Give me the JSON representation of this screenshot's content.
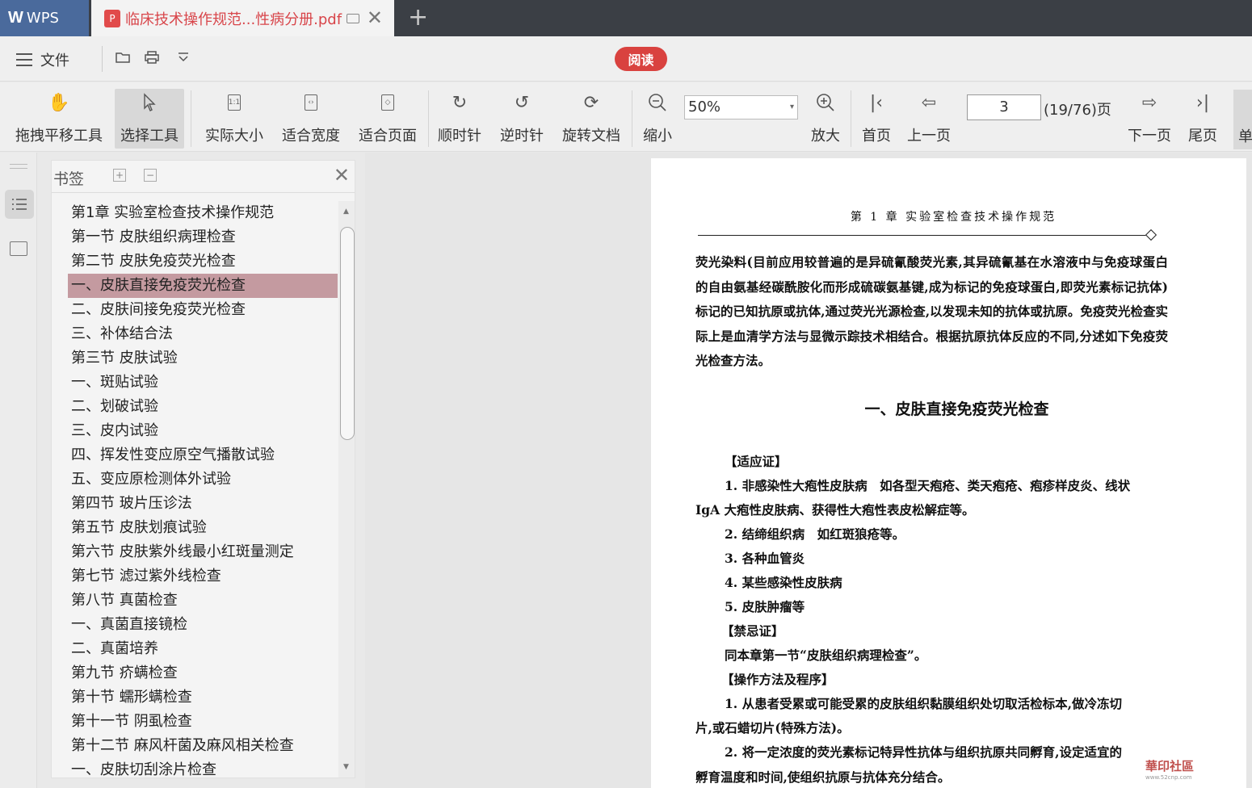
{
  "titlebar": {
    "app_name": "WPS",
    "doc_tab_title": "临床技术操作规范...性病分册.pdf",
    "pdf_badge": "P"
  },
  "menubar": {
    "file_label": "文件",
    "read_label": "阅读"
  },
  "toolbar": {
    "pan_tool": "拖拽平移工具",
    "select_tool": "选择工具",
    "actual_size": "实际大小",
    "fit_width": "适合宽度",
    "fit_page": "适合页面",
    "clockwise": "顺时针",
    "counterclockwise": "逆时针",
    "rotate_doc": "旋转文档",
    "zoom_out": "缩小",
    "zoom_value": "50%",
    "zoom_in": "放大",
    "first_page": "首页",
    "prev_page": "上一页",
    "page_input": "3",
    "page_total": "(19/76)页",
    "next_page": "下一页",
    "last_page": "尾页",
    "single_page": "单"
  },
  "bookmarks": {
    "title": "书签",
    "items": [
      "第1章 实验室检查技术操作规范",
      "第一节 皮肤组织病理检查",
      "第二节 皮肤免疫荧光检查",
      "一、皮肤直接免疫荧光检查",
      "二、皮肤间接免疫荧光检查",
      "三、补体结合法",
      "第三节 皮肤试验",
      "一、斑贴试验",
      "二、划破试验",
      "三、皮内试验",
      "四、挥发性变应原空气播散试验",
      "五、变应原检测体外试验",
      "第四节 玻片压诊法",
      "第五节 皮肤划痕试验",
      "第六节 皮肤紫外线最小红斑量测定",
      "第七节 滤过紫外线检查",
      "第八节 真菌检查",
      "一、真菌直接镜检",
      "二、真菌培养",
      "第九节 疥螨检查",
      "第十节 蠕形螨检查",
      "第十一节 阴虱检查",
      "第十二节 麻风杆菌及麻风相关检查",
      "一、皮肤切刮涂片检查"
    ],
    "selected_index": 3
  },
  "document": {
    "header": "第 1 章 实验室检查技术操作规范",
    "paragraph": "荧光染料(目前应用较普遍的是异硫氰酸荧光素,其异硫氰基在水溶液中与免疫球蛋白的自由氨基经碳酰胺化而形成硫碳氨基键,成为标记的免疫球蛋白,即荧光素标记抗体)标记的已知抗原或抗体,通过荧光光源检查,以发现未知的抗体或抗原。免疫荧光检查实际上是血清学方法与显微示踪技术相结合。根据抗原抗体反应的不同,分述如下免疫荧光检查方法。",
    "heading": "一、皮肤直接免疫荧光检查",
    "lines": [
      "【适应证】",
      "1. 非感染性大疱性皮肤病　如各型天疱疮、类天疱疮、疱疹样皮炎、线状",
      "IgA 大疱性皮肤病、获得性大疱性表皮松解症等。",
      "2. 结缔组织病　如红斑狼疮等。",
      "3. 各种血管炎",
      "4. 某些感染性皮肤病",
      "5. 皮肤肿瘤等",
      "【禁忌证】",
      "同本章第一节“皮肤组织病理检查”。",
      "【操作方法及程序】",
      "1. 从患者受累或可能受累的皮肤组织黏膜组织处切取活检标本,做冷冻切",
      "片,或石蜡切片(特殊方法)。",
      "2. 将一定浓度的荧光素标记特异性抗体与组织抗原共同孵育,设定适宜的",
      "孵育温度和时间,使组织抗原与抗体充分结合。"
    ]
  },
  "watermark": {
    "text": "華印社區",
    "url": "www.52cnp.com"
  }
}
